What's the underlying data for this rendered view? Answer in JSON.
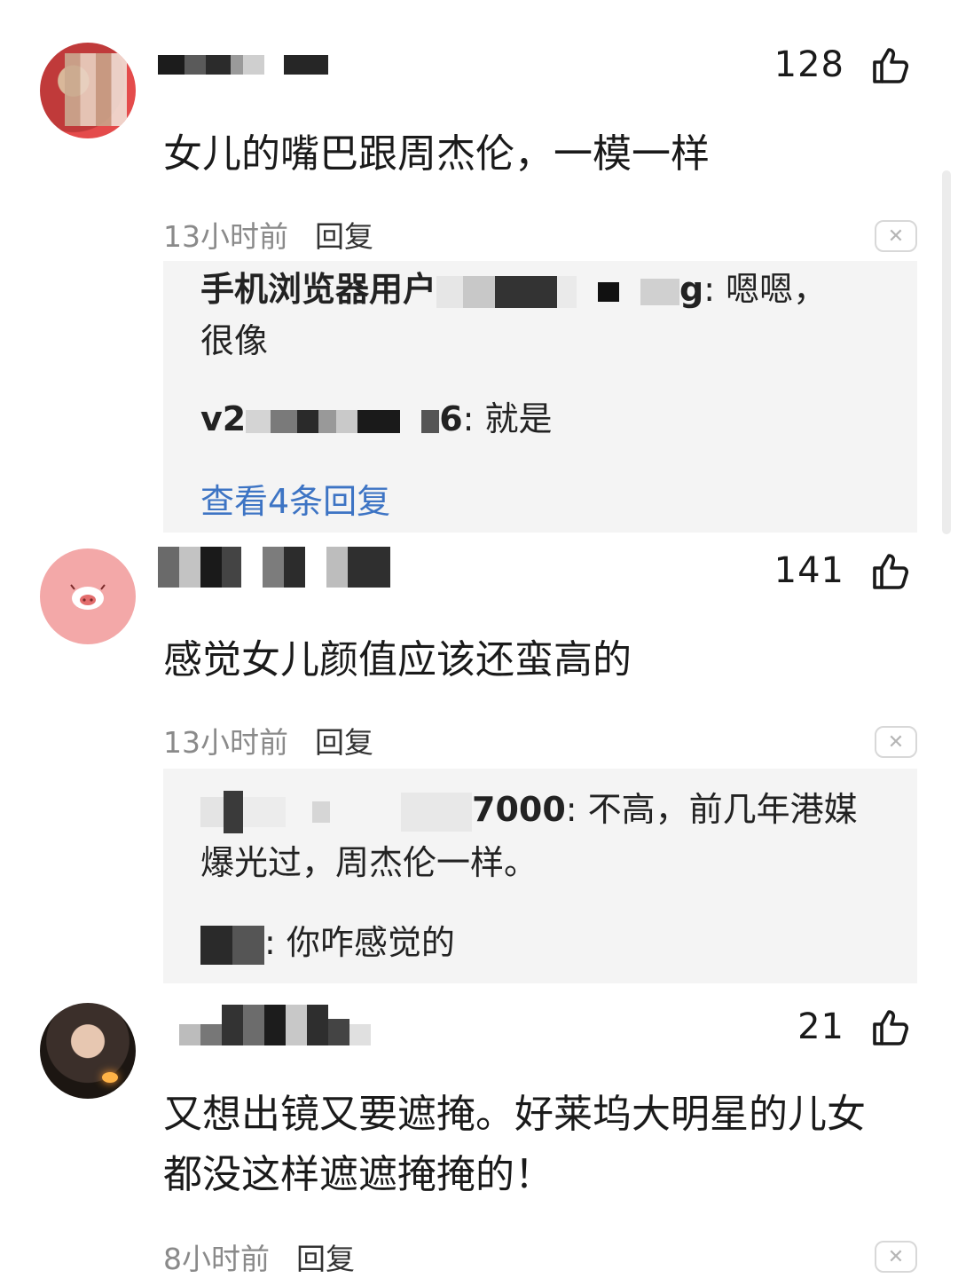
{
  "comments": [
    {
      "likes": "128",
      "text": "女儿的嘴巴跟周杰伦，一模一样",
      "time": "13小时前",
      "reply_label": "回复",
      "replies": [
        {
          "name_visible": "手机浏览器用户",
          "name_tail": "g",
          "text": ": 嗯嗯，",
          "text2": "很像"
        },
        {
          "name_visible": "v2",
          "name_tail": "6",
          "text": ": 就是"
        }
      ],
      "view_more": "查看4条回复"
    },
    {
      "likes": "141",
      "text": "感觉女儿颜值应该还蛮高的",
      "time": "13小时前",
      "reply_label": "回复",
      "replies": [
        {
          "name_tail": "7000",
          "text": ": 不高，前几年港媒",
          "text2": "爆光过，周杰伦一样。"
        },
        {
          "text": ": 你咋感觉的"
        }
      ]
    },
    {
      "likes": "21",
      "text": "又想出镜又要遮掩。好莱坞大明星的儿女都没这样遮遮掩掩的！",
      "time": "8小时前",
      "reply_label": "回复"
    }
  ],
  "icons": {
    "like": "thumbs-up-icon",
    "close": "close-icon"
  },
  "colors": {
    "link": "#3d74c4",
    "reply_bg": "#f4f4f4",
    "meta": "#8a8a8a"
  }
}
